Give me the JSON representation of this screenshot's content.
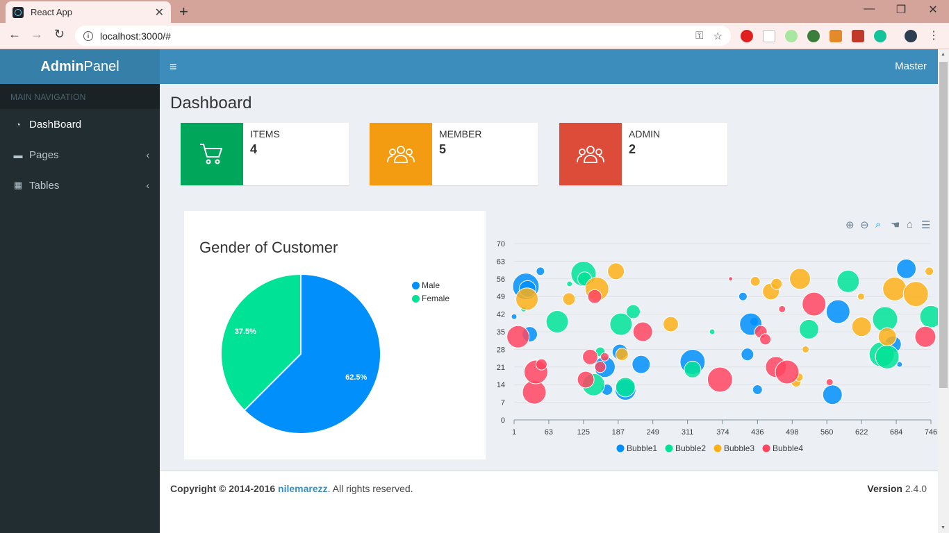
{
  "browser": {
    "tab_title": "React App",
    "url": "localhost:3000/#"
  },
  "app": {
    "logo_bold": "Admin",
    "logo_light": "Panel",
    "user": "Master"
  },
  "sidebar": {
    "header": "MAIN NAVIGATION",
    "items": [
      {
        "label": "DashBoard",
        "icon": "dashboard-icon"
      },
      {
        "label": "Pages",
        "icon": "folder-icon"
      },
      {
        "label": "Tables",
        "icon": "table-icon"
      }
    ]
  },
  "page": {
    "title": "Dashboard"
  },
  "info_boxes": [
    {
      "label": "ITEMS",
      "value": "4",
      "color": "#00a65a",
      "icon": "cart-icon"
    },
    {
      "label": "MEMBER",
      "value": "5",
      "color": "#f39c12",
      "icon": "users-icon"
    },
    {
      "label": "ADMIN",
      "value": "2",
      "color": "#dd4b39",
      "icon": "users-icon"
    }
  ],
  "pie": {
    "title": "Gender of Customer",
    "legend": [
      "Male",
      "Female"
    ]
  },
  "footer": {
    "copyright_prefix": "Copyright © 2014-2016",
    "author": "nilemarezz",
    "suffix": ". All rights reserved.",
    "version_label": "Version",
    "version": "2.4.0"
  },
  "chart_data": [
    {
      "type": "pie",
      "title": "Gender of Customer",
      "categories": [
        "Male",
        "Female"
      ],
      "values": [
        62.5,
        37.5
      ],
      "data_labels": [
        "62.5%",
        "37.5%"
      ],
      "colors": [
        "#008ffb",
        "#00e396"
      ],
      "legend": "top-right"
    },
    {
      "type": "scatter",
      "subtype": "bubble",
      "x_ticks": [
        "1",
        "63",
        "125",
        "187",
        "249",
        "311",
        "374",
        "436",
        "498",
        "560",
        "622",
        "684",
        "746"
      ],
      "y_ticks": [
        "0",
        "7",
        "14",
        "21",
        "28",
        "35",
        "42",
        "49",
        "56",
        "63",
        "70"
      ],
      "xlim": [
        1,
        746
      ],
      "ylim": [
        0,
        70
      ],
      "grid": true,
      "legend": "bottom",
      "series": [
        {
          "name": "Bubble1",
          "color": "#008ffb",
          "points": [
            [
              1,
              41,
              4
            ],
            [
              22,
              53,
              19
            ],
            [
              25,
              52,
              12
            ],
            [
              29,
              34,
              11
            ],
            [
              48,
              59,
              6
            ],
            [
              163,
              21,
              15
            ],
            [
              167,
              12,
              8
            ],
            [
              190,
              27,
              11
            ],
            [
              200,
              12,
              15
            ],
            [
              228,
              22,
              13
            ],
            [
              320,
              23,
              18
            ],
            [
              430,
              39,
              6
            ],
            [
              424,
              38,
              16
            ],
            [
              418,
              26,
              9
            ],
            [
              436,
              12,
              7
            ],
            [
              410,
              49,
              6
            ],
            [
              570,
              10,
              14
            ],
            [
              580,
              43,
              17
            ],
            [
              678,
              30,
              12
            ],
            [
              690,
              22,
              4
            ],
            [
              702,
              60,
              14
            ]
          ]
        },
        {
          "name": "Bubble2",
          "color": "#00e396",
          "points": [
            [
              18,
              44,
              4
            ],
            [
              78,
              39,
              16
            ],
            [
              100,
              54,
              4
            ],
            [
              125,
              58,
              18
            ],
            [
              127,
              56,
              10
            ],
            [
              143,
              14,
              16
            ],
            [
              155,
              27,
              7
            ],
            [
              192,
              38,
              16
            ],
            [
              200,
              13,
              14
            ],
            [
              214,
              43,
              10
            ],
            [
              320,
              20,
              12
            ],
            [
              355,
              35,
              4
            ],
            [
              528,
              36,
              14
            ],
            [
              598,
              55,
              16
            ],
            [
              658,
              26,
              18
            ],
            [
              664,
              40,
              18
            ],
            [
              668,
              25,
              17
            ],
            [
              746,
              41,
              16
            ]
          ]
        },
        {
          "name": "Bubble3",
          "color": "#feb019",
          "points": [
            [
              24,
              48,
              16
            ],
            [
              99,
              48,
              9
            ],
            [
              149,
              52,
              17
            ],
            [
              183,
              59,
              12
            ],
            [
              194,
              26,
              9
            ],
            [
              281,
              38,
              11
            ],
            [
              432,
              55,
              7
            ],
            [
              460,
              51,
              12
            ],
            [
              470,
              54,
              8
            ],
            [
              505,
              15,
              7
            ],
            [
              510,
              17,
              6
            ],
            [
              512,
              56,
              15
            ],
            [
              522,
              28,
              5
            ],
            [
              621,
              49,
              5
            ],
            [
              622,
              37,
              14
            ],
            [
              668,
              33,
              13
            ],
            [
              681,
              52,
              17
            ],
            [
              719,
              50,
              18
            ],
            [
              743,
              59,
              6
            ]
          ]
        },
        {
          "name": "Bubble4",
          "color": "#ff4560",
          "points": [
            [
              8,
              33,
              16
            ],
            [
              37,
              11,
              17
            ],
            [
              40,
              19,
              17
            ],
            [
              50,
              22,
              8
            ],
            [
              129,
              16,
              12
            ],
            [
              137,
              25,
              11
            ],
            [
              145,
              49,
              10
            ],
            [
              155,
              21,
              8
            ],
            [
              163,
              25,
              6
            ],
            [
              231,
              35,
              14
            ],
            [
              369,
              16,
              18
            ],
            [
              388,
              56,
              3
            ],
            [
              442,
              35,
              9
            ],
            [
              450,
              32,
              8
            ],
            [
              469,
              21,
              15
            ],
            [
              480,
              44,
              5
            ],
            [
              489,
              19,
              17
            ],
            [
              537,
              46,
              17
            ],
            [
              565,
              15,
              5
            ],
            [
              736,
              33,
              15
            ]
          ]
        }
      ]
    }
  ]
}
